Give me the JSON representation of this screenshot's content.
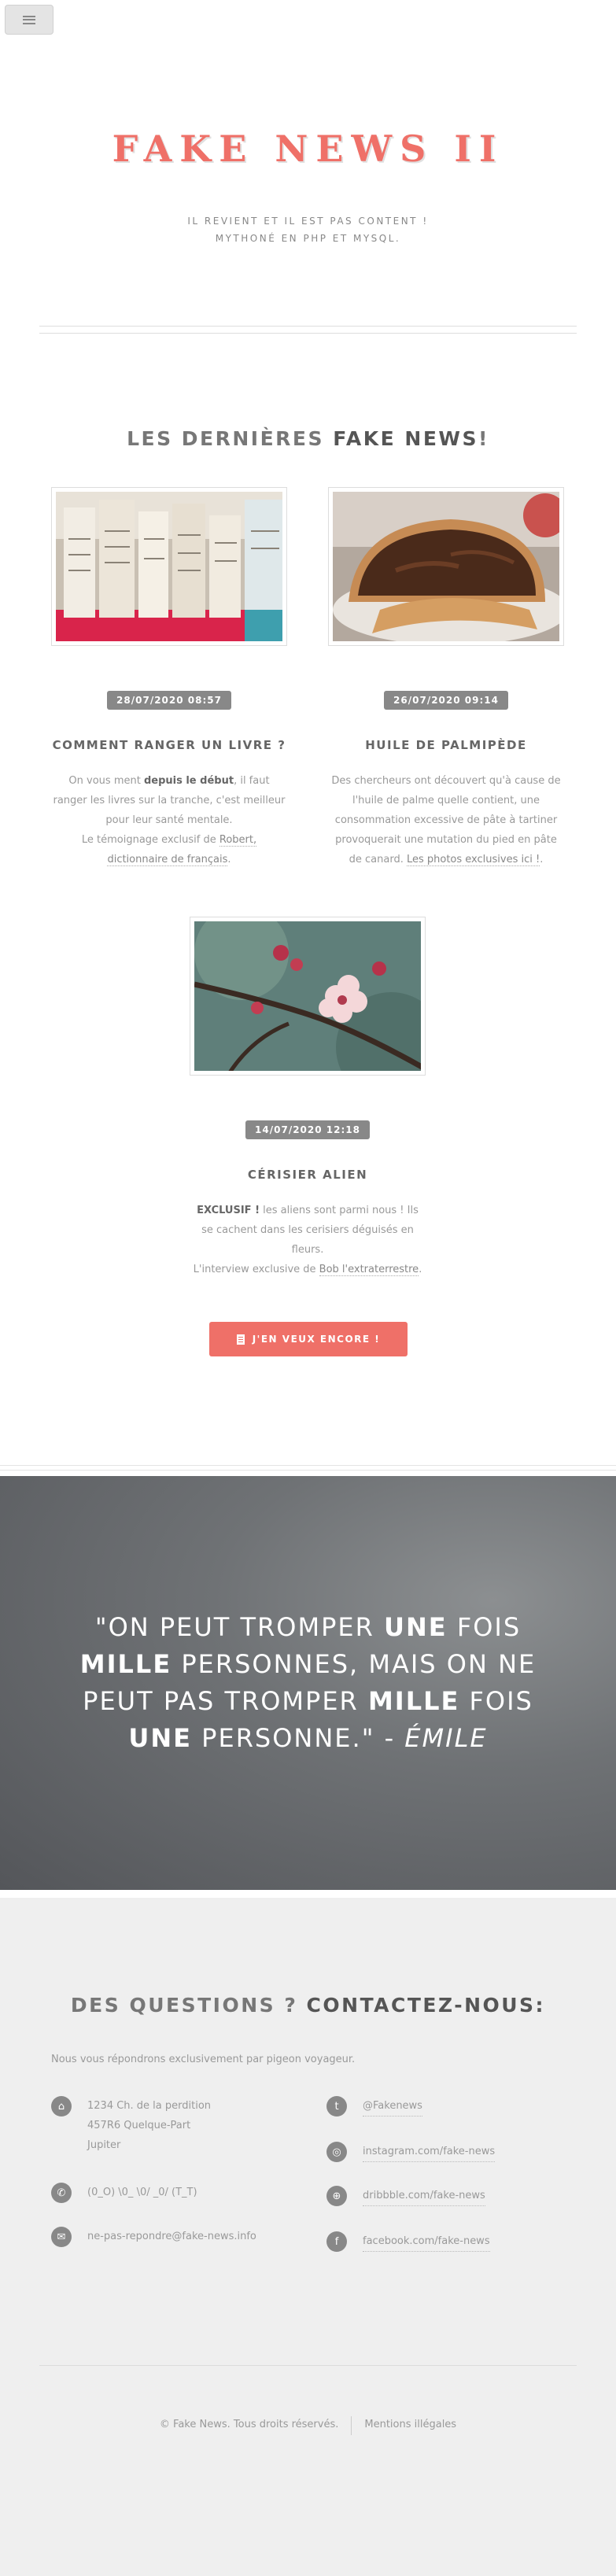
{
  "nav": {
    "menu_icon": "hamburger-icon"
  },
  "header": {
    "title": "FAKE NEWS II",
    "tagline_line1": "IL REVIENT ET IL EST PAS CONTENT !",
    "tagline_line2": "MYTHONÉ EN PHP ET MYSQL."
  },
  "news": {
    "title_pre": "LES DERNIÈRES ",
    "title_bold": "FAKE NEWS",
    "title_post": "!",
    "articles": [
      {
        "date": "28/07/2020 08:57",
        "title": "COMMENT RANGER UN LIVRE ?",
        "text_pre": "On vous ment ",
        "text_bold": "depuis le début",
        "text_mid": ", il faut ranger les livres sur la tranche, c'est meilleur pour leur santé mentale.",
        "text_line2": "Le témoignage exclusif de ",
        "link": "Robert, dictionnaire de français",
        "text_end": "."
      },
      {
        "date": "26/07/2020 09:14",
        "title": "HUILE DE PALMIPÈDE",
        "text_pre": "Des chercheurs ont découvert qu'à cause de l'huile de palme quelle contient, une consommation excessive de pâte à tartiner provoquerait une mutation du pied en pâte de canard. ",
        "link": "Les photos exclusives ici !",
        "text_end": "."
      },
      {
        "date": "14/07/2020 12:18",
        "title": "CÉRISIER ALIEN",
        "text_bold": "EXCLUSIF !",
        "text_pre": " les aliens sont parmi nous ! Ils se cachent dans les cerisiers déguisés en fleurs.",
        "text_line2": "L'interview exclusive de ",
        "link": "Bob l'extraterrestre",
        "text_end": "."
      }
    ],
    "more_button": "J'EN VEUX ENCORE !"
  },
  "quote": {
    "p1": "\"ON PEUT TROMPER ",
    "b1": "UNE",
    "p2": " FOIS ",
    "b2": "MILLE",
    "p3": " PERSONNES, MAIS ON NE PEUT PAS TROMPER ",
    "b3": "MILLE",
    "p4": " FOIS ",
    "b4": "UNE",
    "p5": " PERSONNE.\" - ",
    "author": "ÉMILE"
  },
  "contact": {
    "title_pre": "DES QUESTIONS ? ",
    "title_bold": "CONTACTEZ-NOUS:",
    "subtitle": "Nous vous répondrons exclusivement par pigeon voyageur.",
    "address_line1": "1234 Ch. de la perdition",
    "address_line2": "457R6 Quelque-Part",
    "address_line3": "Jupiter",
    "phone": "(0_O) \\0_ \\0/ _0/ (T_T)",
    "email": "ne-pas-repondre@fake-news.info",
    "twitter": "@Fakenews",
    "instagram": "instagram.com/fake-news",
    "dribbble": "dribbble.com/fake-news",
    "facebook": "facebook.com/fake-news"
  },
  "footer": {
    "copyright": "© Fake News. Tous droits réservés.",
    "legal": "Mentions illégales"
  }
}
